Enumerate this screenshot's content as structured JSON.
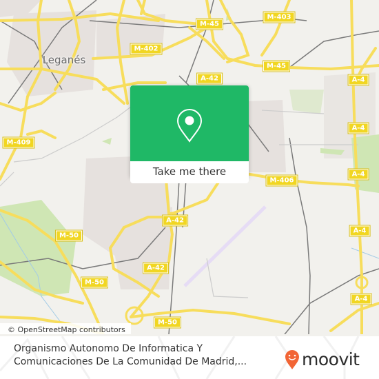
{
  "map": {
    "city_label": "Leganés",
    "road_shields": [
      {
        "label": "M-45",
        "id": "m45-north"
      },
      {
        "label": "M-403",
        "id": "m403"
      },
      {
        "label": "M-402",
        "id": "m402"
      },
      {
        "label": "M-45",
        "id": "m45-east"
      },
      {
        "label": "A-42",
        "id": "a42-north"
      },
      {
        "label": "A-4",
        "id": "a4-1"
      },
      {
        "label": "M-409",
        "id": "m409"
      },
      {
        "label": "A-4",
        "id": "a4-2"
      },
      {
        "label": "M-406",
        "id": "m406"
      },
      {
        "label": "A-4",
        "id": "a4-3"
      },
      {
        "label": "A-42",
        "id": "a42-mid"
      },
      {
        "label": "M-50",
        "id": "m50-west"
      },
      {
        "label": "A-4",
        "id": "a4-4"
      },
      {
        "label": "A-42",
        "id": "a42-south"
      },
      {
        "label": "M-50",
        "id": "m50-mid"
      },
      {
        "label": "A-4",
        "id": "a4-5"
      },
      {
        "label": "M-50",
        "id": "m50-south"
      }
    ],
    "attribution": "© OpenStreetMap contributors",
    "colors": {
      "land": "#f2f1ed",
      "urban": "#e6e1de",
      "park": "#cfe6b4",
      "road": "#f7dd5c",
      "rail": "#7a7a7a",
      "runway": "#e6dcf5",
      "shield": "#f1d622"
    }
  },
  "popup": {
    "icon": "location-pin-icon",
    "button_label": "Take me there",
    "color": "#1fb866"
  },
  "footer": {
    "place_name": "Organismo Autonomo De Informatica Y Comunicaciones De La Comunidad De Madrid,...",
    "brand": "moovit",
    "brand_color": "#f26535"
  }
}
